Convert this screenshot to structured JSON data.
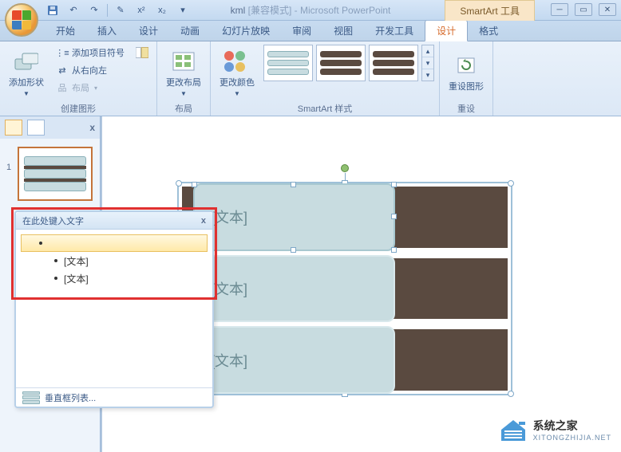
{
  "title": {
    "doc": "kml",
    "mode": "[兼容模式]",
    "app": "Microsoft PowerPoint"
  },
  "context_tool": "SmartArt 工具",
  "tabs": [
    "开始",
    "插入",
    "设计",
    "动画",
    "幻灯片放映",
    "审阅",
    "视图",
    "开发工具",
    "设计",
    "格式"
  ],
  "active_tab_index": 8,
  "ribbon": {
    "group1": {
      "label": "创建图形",
      "add_shape": "添加形状",
      "bullets": "添加项目符号",
      "rtl": "从右向左",
      "layout": "布局"
    },
    "group2": {
      "label": "布局",
      "change_layout": "更改布局"
    },
    "group3": {
      "label": "SmartArt 样式",
      "change_colors": "更改颜色"
    },
    "group4": {
      "label": "重设",
      "reset": "重设图形"
    }
  },
  "smartart": {
    "placeholder": "[文本]",
    "side_left": "◀",
    "side_right": "▶"
  },
  "textpane": {
    "title": "在此处键入文字",
    "items": [
      {
        "text": "",
        "sel": true,
        "sub": false
      },
      {
        "text": "[文本]",
        "sel": false,
        "sub": true
      },
      {
        "text": "[文本]",
        "sel": false,
        "sub": true
      }
    ],
    "footer": "垂直框列表..."
  },
  "slide_num": "1",
  "watermark": {
    "name": "系统之家",
    "url": "XITONGZHIJIA.NET"
  }
}
